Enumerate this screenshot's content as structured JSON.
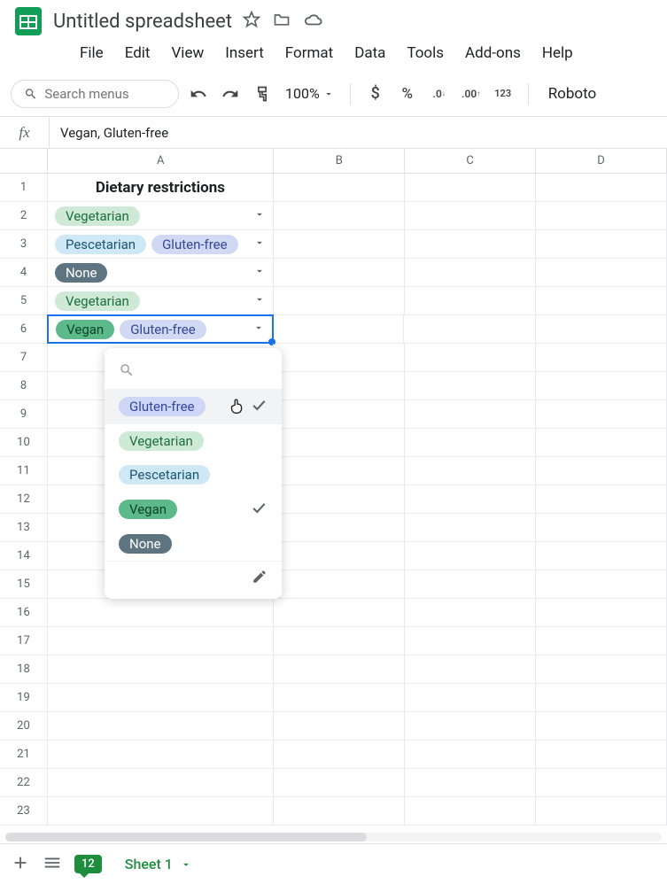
{
  "title": "Untitled spreadsheet",
  "menus": [
    "File",
    "Edit",
    "View",
    "Insert",
    "Format",
    "Data",
    "Tools",
    "Add-ons",
    "Help"
  ],
  "search_placeholder": "Search menus",
  "zoom": "100%",
  "font": "Roboto",
  "formula": "Vegan, Gluten-free",
  "columns": [
    "A",
    "B",
    "C",
    "D"
  ],
  "rows": [
    "1",
    "2",
    "3",
    "4",
    "5",
    "6",
    "7",
    "8",
    "9",
    "10",
    "11",
    "12",
    "13",
    "14",
    "15",
    "16",
    "17",
    "18",
    "19",
    "20",
    "21",
    "22",
    "23"
  ],
  "header_cell": "Dietary restrictions",
  "cell_data": [
    {
      "row": "2",
      "chips": [
        {
          "label": "Vegetarian",
          "class": "vegetarian"
        }
      ]
    },
    {
      "row": "3",
      "chips": [
        {
          "label": "Pescetarian",
          "class": "pescetarian"
        },
        {
          "label": "Gluten-free",
          "class": "gluten-free"
        }
      ]
    },
    {
      "row": "4",
      "chips": [
        {
          "label": "None",
          "class": "none"
        }
      ]
    },
    {
      "row": "5",
      "chips": [
        {
          "label": "Vegetarian",
          "class": "vegetarian"
        }
      ]
    },
    {
      "row": "6",
      "chips": [
        {
          "label": "Vegan",
          "class": "vegan"
        },
        {
          "label": "Gluten-free",
          "class": "gluten-free"
        }
      ],
      "active": true
    }
  ],
  "popup": {
    "items": [
      {
        "label": "Gluten-free",
        "class": "popup",
        "checked": true,
        "hover": true
      },
      {
        "label": "Vegetarian",
        "class": "vegetarian",
        "checked": false
      },
      {
        "label": "Pescetarian",
        "class": "pescetarian",
        "checked": false
      },
      {
        "label": "Vegan",
        "class": "vegan",
        "checked": true
      },
      {
        "label": "None",
        "class": "none",
        "checked": false
      }
    ]
  },
  "chat_count": "12",
  "sheet_name": "Sheet 1"
}
